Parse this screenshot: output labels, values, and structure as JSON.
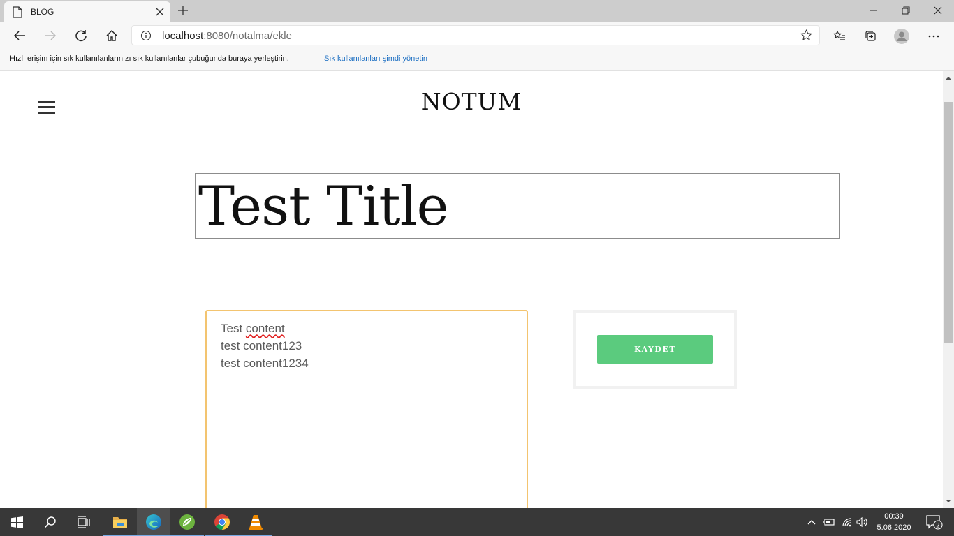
{
  "browser": {
    "tab_title": "BLOG",
    "url_host": "localhost",
    "url_rest": ":8080/notalma/ekle",
    "favorites_message": "Hızlı erişim için sık kullanılanlarınızı sık kullanılanlar çubuğunda buraya yerleştirin.",
    "favorites_link": "Sık kullanılanları şimdi yönetin"
  },
  "page": {
    "site_title": "NOTUM",
    "title_value": "Test Title",
    "content_lines": [
      {
        "text": "Test content",
        "misspelled_word": "content"
      },
      {
        "text": "test content123"
      },
      {
        "text": "test content1234"
      }
    ],
    "save_label": "KAYDET"
  },
  "taskbar": {
    "time": "00:39",
    "date": "5.06.2020",
    "notification_count": "2",
    "apps": [
      "start-icon",
      "search-icon",
      "task-view-icon",
      "file-explorer-icon",
      "edge-icon",
      "spring-tool-suite-icon",
      "chrome-icon",
      "vlc-icon"
    ]
  },
  "colors": {
    "accent_green": "#5bcb7e",
    "textarea_border": "#f3c470",
    "link_blue": "#1b6ec2",
    "taskbar_bg": "#383838"
  }
}
